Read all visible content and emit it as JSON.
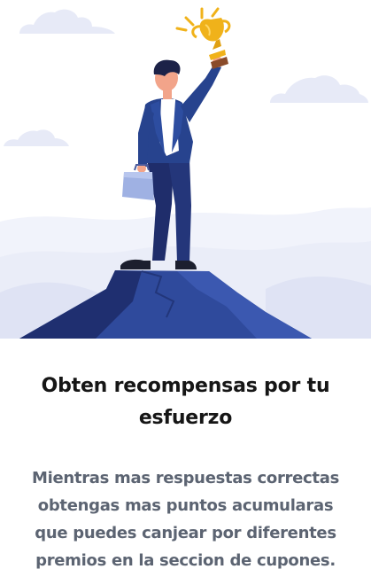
{
  "onboarding": {
    "title_lines": [
      "Obten recompensas por tu",
      "esfuerzo"
    ],
    "description_lines": [
      "Mientras mas respuestas correctas",
      "obtengas mas puntos acumularas",
      "que puedes canjear por diferentes",
      "premios en la seccion de cupones."
    ]
  },
  "colors": {
    "background": "#ffffff",
    "title": "#161616",
    "description": "#5c6472",
    "mountain": "#2f4a9c",
    "mountain_shadow": "#1f2f70",
    "suit": "#27438e",
    "trophy": "#f0b21a",
    "clouds": "#e6e9f7"
  },
  "illustration": {
    "name": "man-with-trophy-on-mountain"
  }
}
